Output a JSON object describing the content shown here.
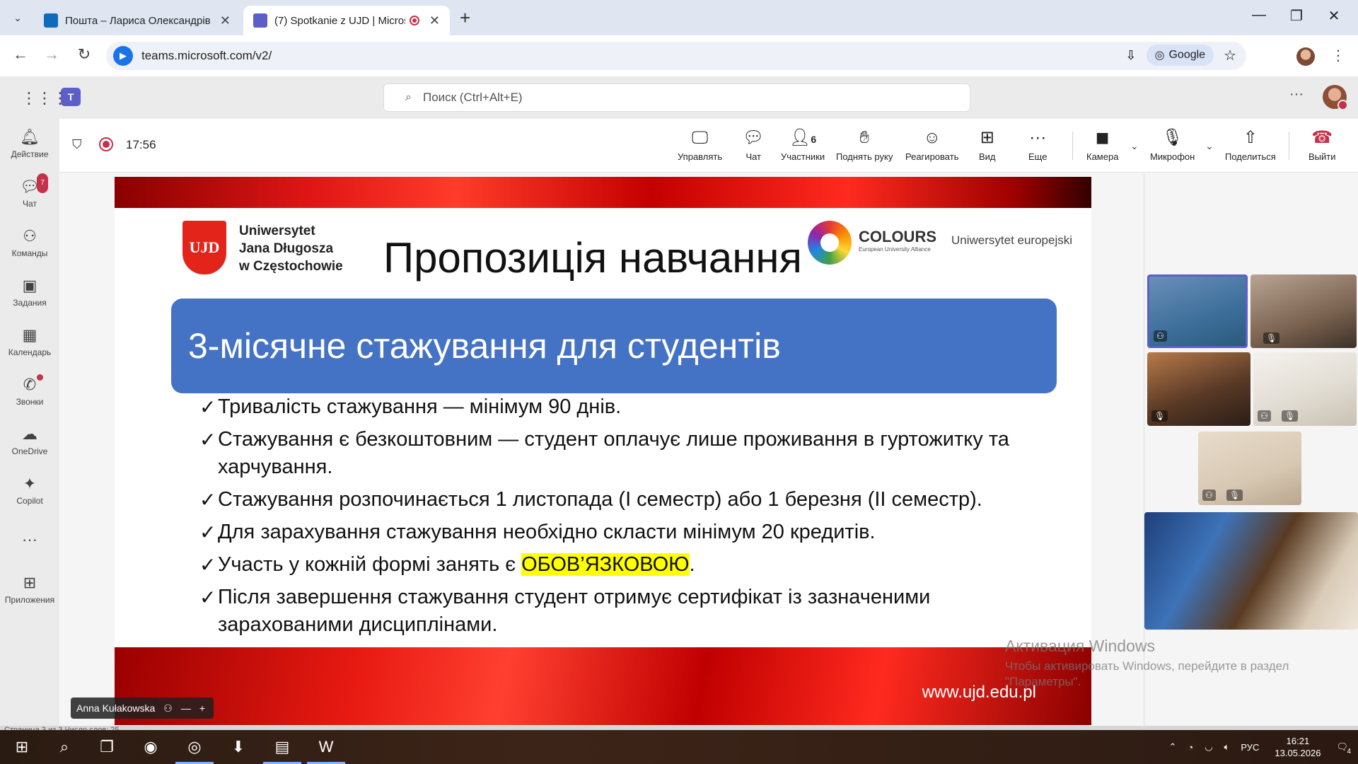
{
  "browser": {
    "tabs": [
      {
        "title": "Пошта – Лариса Олександрівн",
        "active": false
      },
      {
        "title": "(7) Spotkanie z UJD | Micros",
        "active": true
      }
    ],
    "new_tab": "+",
    "url": "teams.microsoft.com/v2/",
    "google_label": "Google",
    "window_controls": {
      "minimize": "—",
      "maximize": "❐",
      "close": "✕"
    }
  },
  "teams_header": {
    "search_placeholder": "Поиск (Ctrl+Alt+E)"
  },
  "rail": [
    {
      "label": "Действие",
      "icon": "bell-icon",
      "glyph": "🔔"
    },
    {
      "label": "Чат",
      "icon": "chat-icon",
      "glyph": "💬",
      "badge": "7"
    },
    {
      "label": "Команды",
      "icon": "teams-icon",
      "glyph": "👥"
    },
    {
      "label": "Задания",
      "icon": "assignments-icon",
      "glyph": "🎒"
    },
    {
      "label": "Календарь",
      "icon": "calendar-icon",
      "glyph": "📅"
    },
    {
      "label": "Звонки",
      "icon": "phone-icon",
      "glyph": "📞",
      "dot": true
    },
    {
      "label": "OneDrive",
      "icon": "cloud-icon",
      "glyph": "☁"
    },
    {
      "label": "Copilot",
      "icon": "copilot-icon",
      "glyph": "✦"
    },
    {
      "label": "",
      "icon": "more-icon",
      "glyph": "···"
    },
    {
      "label": "Приложения",
      "icon": "apps-icon",
      "glyph": "⊞"
    }
  ],
  "meeting": {
    "timer": "17:56",
    "toolbar": [
      {
        "label": "Управлять",
        "icon": "present-icon",
        "glyph": "🖵"
      },
      {
        "label": "Чат",
        "icon": "chat-icon",
        "glyph": "💬"
      },
      {
        "label": "Участники",
        "icon": "people-icon",
        "glyph": "👤",
        "count": "6"
      },
      {
        "label": "Поднять руку",
        "icon": "raise-hand-icon",
        "glyph": "✋"
      },
      {
        "label": "Реагировать",
        "icon": "smile-icon",
        "glyph": "☺"
      },
      {
        "label": "Вид",
        "icon": "view-grid-icon",
        "glyph": "⊞"
      },
      {
        "label": "Еще",
        "icon": "more-icon",
        "glyph": "···"
      },
      {
        "label": "Камера",
        "icon": "camera-icon",
        "glyph": "■"
      },
      {
        "label": "Микрофон",
        "icon": "microphone-icon",
        "glyph": "🎙"
      },
      {
        "label": "Поделиться",
        "icon": "share-icon",
        "glyph": "⇧"
      },
      {
        "label": "Выйти",
        "icon": "hang-up-icon",
        "glyph": "☎"
      }
    ]
  },
  "slide": {
    "university": [
      "Uniwersytet",
      "Jana Długosza",
      "w Częstochowie"
    ],
    "logo_text": "UJD",
    "colours_title": "COLOURS",
    "colours_sub": "European University Alliance",
    "colours_uni": "Uniwersytet europejski",
    "heading": "Пропозиція навчання",
    "banner": "3-місячне стажування для студентів",
    "bullets": [
      {
        "text": "Тривалість стажування — мінімум 90 днів."
      },
      {
        "text": "Стажування є безкоштовним — студент оплачує лише проживання в гуртожитку та харчування."
      },
      {
        "text": "Стажування розпочинається 1 листопада (I семестр) або 1 березня (II семестр)."
      },
      {
        "text": "Для зарахування стажування необхідно скласти мінімум 20 кредитів."
      },
      {
        "text_before": "Участь у кожній формі занять є ",
        "highlight": "ОБОВ’ЯЗКОВОЮ",
        "text_after": "."
      },
      {
        "text": "Після завершення стажування студент отримує сертифікат із зазначеними зарахованими дисциплінами."
      }
    ],
    "website": "www.ujd.edu.pl"
  },
  "presenter": {
    "name": "Anna Kułakowska",
    "minus": "—",
    "plus": "+"
  },
  "activation": {
    "title": "Активация Windows",
    "subtitle_1": "Чтобы активировать Windows, перейдите в раздел",
    "subtitle_2": "\"Параметры\"."
  },
  "word_status": "Страница 3 из 3    Число слов: 25",
  "taskbar": {
    "language": "РУС",
    "time": "16:21",
    "date": "13.05.2026",
    "notification_count": "4"
  }
}
